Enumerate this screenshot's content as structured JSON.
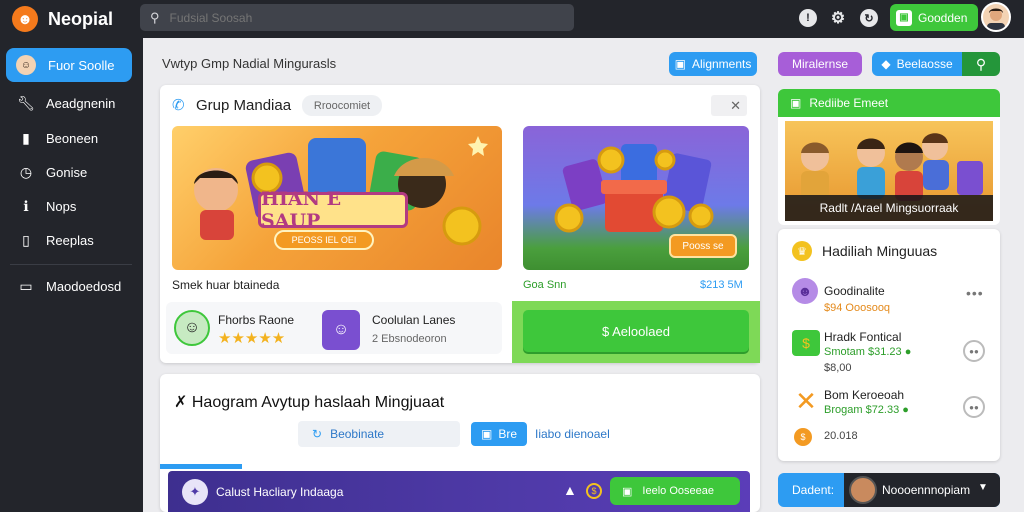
{
  "app": {
    "title": "Neopial"
  },
  "search": {
    "placeholder": "Fudsial Soosah"
  },
  "topbar": {
    "action_label": "Goodden"
  },
  "sidebar": {
    "items": [
      {
        "label": "Fuor Soolle",
        "icon": "avatar-icon",
        "active": true
      },
      {
        "label": "Aeadgnenin",
        "icon": "wrench-icon"
      },
      {
        "label": "Beoneen",
        "icon": "document-icon"
      },
      {
        "label": "Gonise",
        "icon": "clock-icon"
      },
      {
        "label": "Nops",
        "icon": "info-icon"
      },
      {
        "label": "Reeplas",
        "icon": "file-icon"
      },
      {
        "label": "Maodoedosd",
        "icon": "window-icon"
      }
    ]
  },
  "main": {
    "title": "Vwtyp Gmp Nadial Mingurasls",
    "buttons": {
      "alignments": "Alignments",
      "miraleinse": "Miralernse",
      "beeloesse": "Beelaosse"
    }
  },
  "group_card": {
    "title": "Grup Mandiaa",
    "tag": "Rroocomiet",
    "banner1_text": "HIAN E SAUP",
    "banner1_sub": "PEOSS IEL OEI",
    "banner2_sub": "Pooss se",
    "caption_left": "Smek huar btaineda",
    "caption_right_left": "Goa Snn",
    "caption_right_right": "$213 5M",
    "user1": {
      "name": "Fhorbs Raone",
      "stars": "★★★★★"
    },
    "user2": {
      "name": "Coolulan Lanes",
      "sub": "2 Ebsnodeoron"
    },
    "action_btn": "$ Aeloolaed"
  },
  "lower_card": {
    "title": "Haogram Avytup haslaah Mingjuaat",
    "btn1": "Beobinate",
    "btn2": "Bre",
    "link": "Iiabo dienoael",
    "bar_text": "Calust Hacliary Indaaga",
    "bar_btn": "Ieelo Ooseeae"
  },
  "right_panel": {
    "card_title": "Rediibe Emeet",
    "card_caption": "Radlt /Arael Mingsuorraak",
    "list_title": "Hadiliah Minguuas",
    "items": [
      {
        "title": "Goodinalite",
        "sub": "$94 Ooosooq",
        "sub_color": "#e48a1c"
      },
      {
        "title": "Hradk Fontical",
        "sub": "Smotam $31.23 ●",
        "sub2": "$8,00"
      },
      {
        "title": "Bom Keroeoah",
        "sub": "Brogam $72.33 ●",
        "sub2": "20.018"
      }
    ],
    "footer_label": "Dadent:",
    "footer_name": "Noooennnopiam"
  },
  "colors": {
    "accent_blue": "#2d9cf2",
    "accent_green": "#3ec73b",
    "accent_purple": "#a75ed8",
    "dark": "#23252b"
  }
}
